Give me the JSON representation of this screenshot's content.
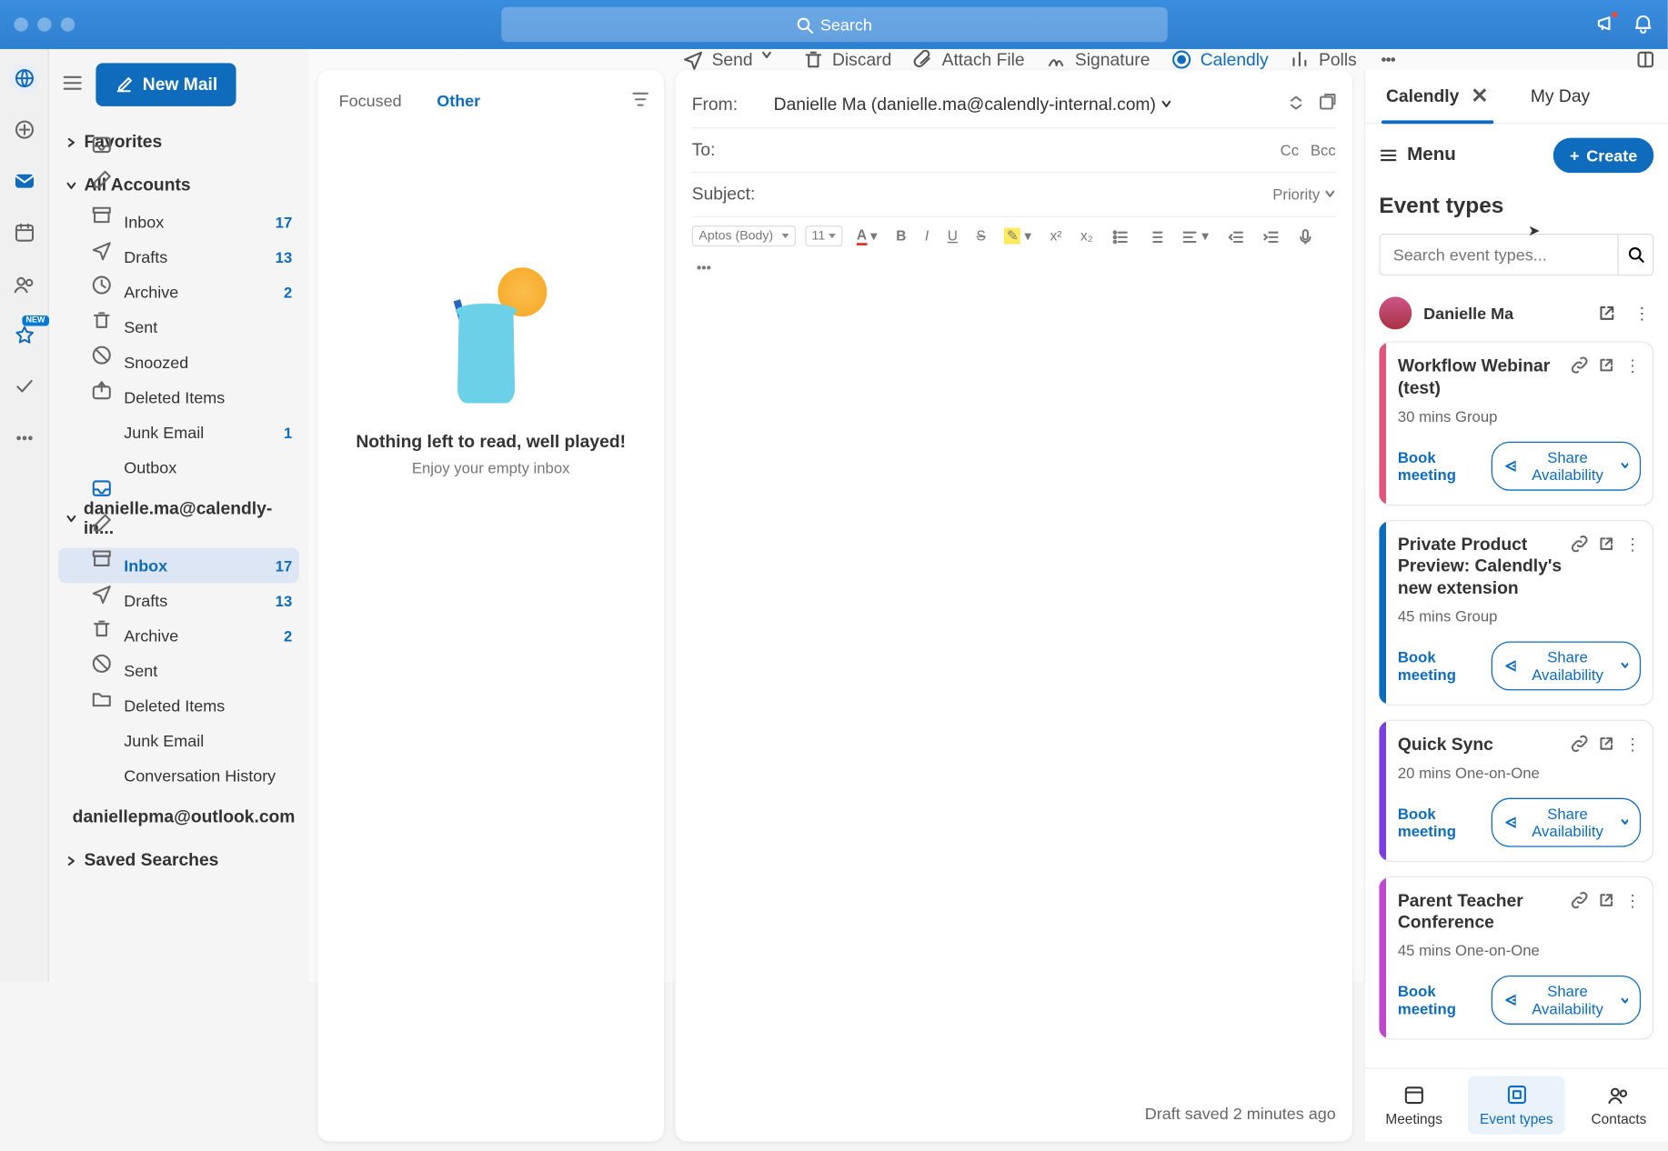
{
  "title_search": "Search",
  "new_mail": "New Mail",
  "sidebar": {
    "favorites": "Favorites",
    "all_accounts": "All Accounts",
    "acct1": "danielle.ma@calendly-in...",
    "acct2": "daniellepma@outlook.com",
    "saved": "Saved Searches",
    "inbox": "Inbox",
    "inbox_count": "17",
    "drafts": "Drafts",
    "drafts_count": "13",
    "archive": "Archive",
    "archive_count": "2",
    "sent": "Sent",
    "snoozed": "Snoozed",
    "deleted": "Deleted Items",
    "junk": "Junk Email",
    "junk_count": "1",
    "outbox": "Outbox",
    "convhist": "Conversation History"
  },
  "toolbar": {
    "send": "Send",
    "discard": "Discard",
    "attach": "Attach File",
    "signature": "Signature",
    "calendly": "Calendly",
    "polls": "Polls"
  },
  "msglist": {
    "focused": "Focused",
    "other": "Other",
    "empty_title": "Nothing left to read, well played!",
    "empty_sub": "Enjoy your empty inbox"
  },
  "compose": {
    "from_label": "From:",
    "from_value": "Danielle Ma (danielle.ma@calendly-internal.com)",
    "to_label": "To:",
    "cc": "Cc",
    "bcc": "Bcc",
    "subject_label": "Subject:",
    "priority": "Priority",
    "font": "Aptos (Body)",
    "size": "11",
    "status": "Draft saved 2 minutes ago"
  },
  "panel": {
    "tab_active": "Calendly",
    "tab_myday": "My Day",
    "menu": "Menu",
    "create": "Create",
    "heading": "Event types",
    "search_ph": "Search event types...",
    "user": "Danielle Ma",
    "book": "Book meeting",
    "share": "Share Availability",
    "items": [
      {
        "title": "Workflow Webinar (test)",
        "meta": "30 mins  Group",
        "accent": "#e0557b"
      },
      {
        "title": "Private Product Preview: Calendly's new extension",
        "meta": "45 mins  Group",
        "accent": "#0f6cbd"
      },
      {
        "title": "Quick Sync",
        "meta": "20 mins  One-on-One",
        "accent": "#7a3fe0"
      },
      {
        "title": "Parent Teacher Conference",
        "meta": "45 mins  One-on-One",
        "accent": "#c048d0"
      }
    ],
    "bottom": {
      "meetings": "Meetings",
      "events": "Event types",
      "contacts": "Contacts"
    }
  }
}
